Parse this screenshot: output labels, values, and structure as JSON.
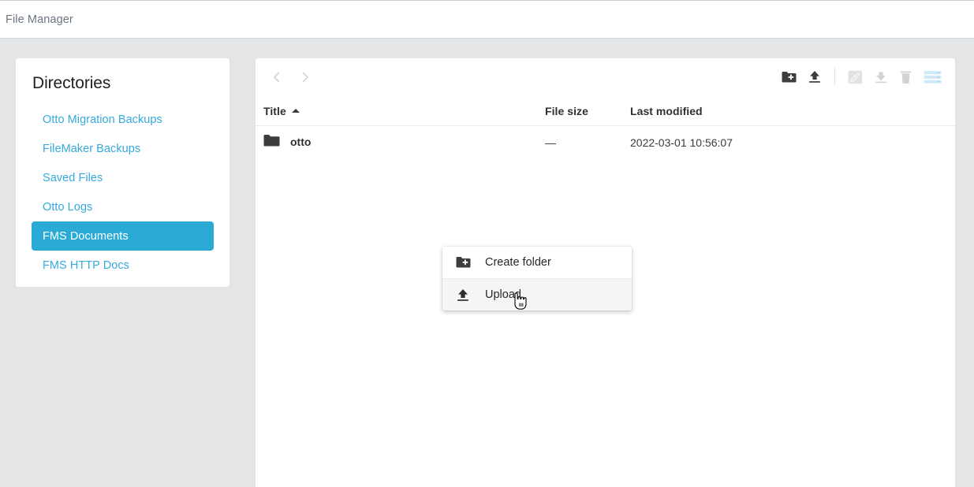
{
  "app": {
    "title": "File Manager"
  },
  "sidebar": {
    "title": "Directories",
    "items": [
      {
        "label": "Otto Migration Backups",
        "active": false
      },
      {
        "label": "FileMaker Backups",
        "active": false
      },
      {
        "label": "Saved Files",
        "active": false
      },
      {
        "label": "Otto Logs",
        "active": false
      },
      {
        "label": "FMS Documents",
        "active": true
      },
      {
        "label": "FMS HTTP Docs",
        "active": false
      }
    ]
  },
  "toolbar": {
    "nav": [
      {
        "name": "back-icon",
        "enabled": false
      },
      {
        "name": "forward-icon",
        "enabled": false
      }
    ],
    "actions": [
      {
        "name": "create-folder-icon",
        "enabled": true
      },
      {
        "name": "upload-icon",
        "enabled": true
      },
      {
        "name": "rename-icon",
        "enabled": false
      },
      {
        "name": "download-icon",
        "enabled": false
      },
      {
        "name": "delete-icon",
        "enabled": false
      },
      {
        "name": "view-list-icon",
        "enabled": true
      }
    ]
  },
  "table": {
    "columns": {
      "title": "Title",
      "file_size": "File size",
      "last_modified": "Last modified"
    },
    "sort": {
      "column": "Title",
      "direction": "ascending"
    },
    "rows": [
      {
        "icon": "folder-icon",
        "title": "otto",
        "file_size": "—",
        "last_modified": "2022-03-01 10:56:07"
      }
    ]
  },
  "context_menu": {
    "items": [
      {
        "icon": "create-folder-icon",
        "label": "Create folder",
        "hover": false
      },
      {
        "icon": "upload-icon",
        "label": "Upload",
        "hover": true
      }
    ]
  },
  "colors": {
    "accent": "#29abd6",
    "link": "#36a9dd",
    "page_bg": "#e3e5e7",
    "icon_dark": "#3d3d3d",
    "icon_disabled": "#d6d6d6",
    "view_icon": "#cfeaf7"
  }
}
